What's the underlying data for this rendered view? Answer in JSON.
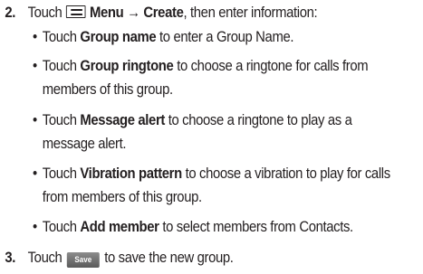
{
  "steps": [
    {
      "number": "2.",
      "text_before": "Touch",
      "menu_icon": "menu-icon",
      "menu_label": "Menu",
      "arrow": "→",
      "create_label": "Create",
      "text_after": ", then enter information:",
      "bullets": [
        {
          "prefix": "Touch",
          "bold": "Group name",
          "lines": [
            "to enter a Group Name."
          ]
        },
        {
          "prefix": "Touch",
          "bold": "Group ringtone",
          "lines": [
            "to choose a ringtone for calls from",
            "members of this group."
          ]
        },
        {
          "prefix": "Touch",
          "bold": "Message alert",
          "lines": [
            "to choose a ringtone to play as a",
            "message alert."
          ]
        },
        {
          "prefix": "Touch",
          "bold": "Vibration pattern",
          "lines": [
            "to choose a vibration to play for calls",
            "from members of this group."
          ]
        },
        {
          "prefix": "Touch",
          "bold": "Add member",
          "lines": [
            "to select members from Contacts."
          ]
        }
      ]
    },
    {
      "number": "3.",
      "text_before": "Touch",
      "button_label": "Save",
      "text_after": "to save the new group."
    }
  ],
  "bullet_char": "•"
}
